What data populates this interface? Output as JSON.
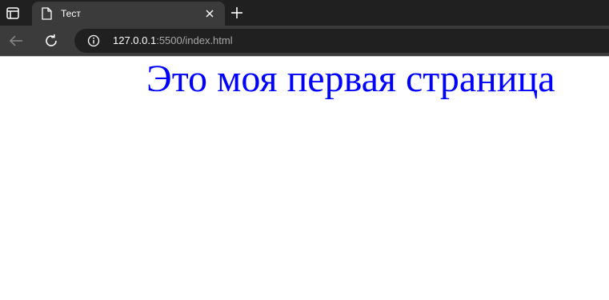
{
  "browser": {
    "tab": {
      "title": "Тест",
      "icon": "document-icon"
    },
    "toolbar": {
      "url_host": "127.0.0.1",
      "url_rest": ":5500/index.html"
    }
  },
  "page": {
    "heading": "Это моя первая страница",
    "heading_color": "#0000ff"
  }
}
